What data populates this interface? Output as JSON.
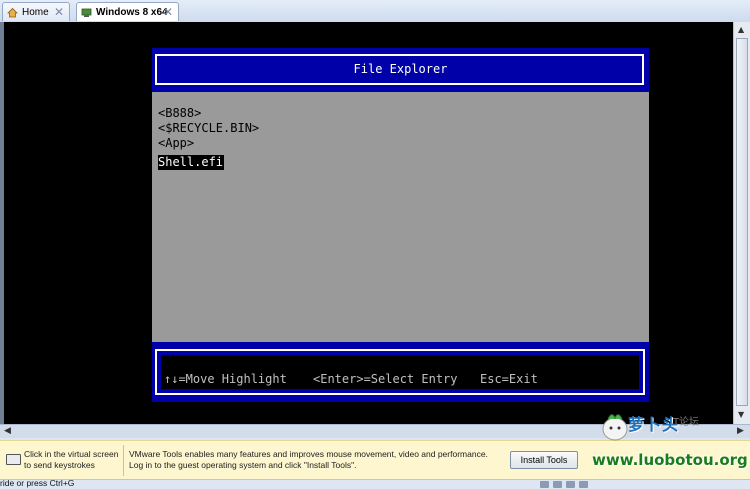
{
  "tabs": [
    {
      "label": "Home",
      "icon": "home-icon"
    },
    {
      "label": "Windows 8 x64",
      "icon": "vm-icon",
      "active": true
    }
  ],
  "file_explorer": {
    "title": "File Explorer",
    "entries": [
      "<B888>",
      "<$RECYCLE.BIN>",
      "<App>",
      "Shell.efi"
    ],
    "selected_entry": "Shell.efi",
    "help": {
      "move": "↑↓=Move Highlight",
      "select": "<Enter>=Select Entry",
      "exit": "Esc=Exit"
    }
  },
  "hint_bar": {
    "message_1": "Click in the virtual screen to send keystrokes",
    "message_2": "VMware Tools enables many features and improves mouse movement, video and performance. Log in to the guest operating system and click \"Install Tools\".",
    "install_button": "Install Tools"
  },
  "watermark": {
    "brand": "萝卜头",
    "sub": "IT论坛",
    "url": "www.luobotou.org"
  },
  "status_bar": {
    "text": "ride or press Ctrl+G"
  },
  "colors": {
    "uefi_blue": "#0000a8",
    "uefi_gray": "#9a9a9a",
    "hint_background": "#fdf6cf"
  }
}
